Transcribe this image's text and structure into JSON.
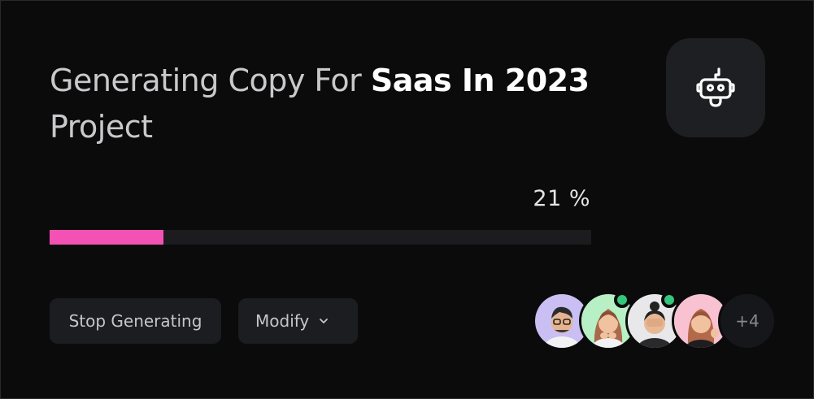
{
  "title": {
    "prefix": "Generating Copy For ",
    "highlight": "Saas In 2023",
    "suffix": "Project"
  },
  "bot_icon": "robot-icon",
  "progress": {
    "label": "21 %",
    "value": 0.21,
    "fill_color": "#f351b3"
  },
  "actions": {
    "stop_label": "Stop Generating",
    "modify_label": "Modify",
    "modify_icon": "chevron-down-icon"
  },
  "team": {
    "avatars": [
      {
        "name": "avatar-1",
        "online": false,
        "bg": "#c9bff2"
      },
      {
        "name": "avatar-2",
        "online": true,
        "bg": "#b8f0c6"
      },
      {
        "name": "avatar-3",
        "online": true,
        "bg": "#e8e8ea"
      },
      {
        "name": "avatar-4",
        "online": false,
        "bg": "#f8c2d2"
      }
    ],
    "more_label": "+4"
  }
}
